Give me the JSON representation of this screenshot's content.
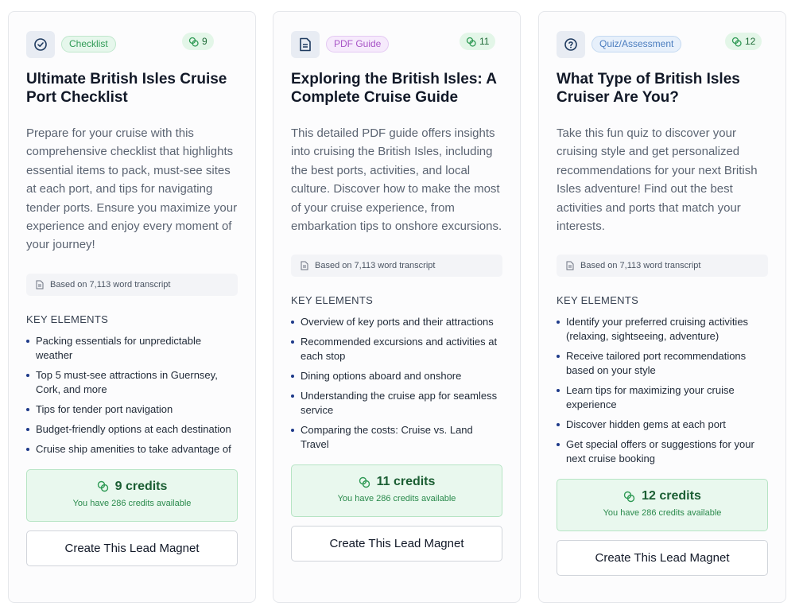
{
  "cards": [
    {
      "type_icon": "check-circle-icon",
      "type_label": "Checklist",
      "credit_count": "9",
      "title": "Ultimate British Isles Cruise Port Checklist",
      "description": "Prepare for your cruise with this comprehensive checklist that highlights essential items to pack, must-see sites at each port, and tips for navigating tender ports. Ensure you maximize your experience and enjoy every moment of your journey!",
      "transcript": "Based on 7,113 word transcript",
      "key_elements_title": "KEY ELEMENTS",
      "key_elements": [
        "Packing essentials for unpredictable weather",
        "Top 5 must-see attractions in Guernsey, Cork, and more",
        "Tips for tender port navigation",
        "Budget-friendly options at each destination",
        "Cruise ship amenities to take advantage of"
      ],
      "credits_label": "9 credits",
      "credits_available": "You have 286 credits available",
      "button_label": "Create This Lead Magnet"
    },
    {
      "type_icon": "document-icon",
      "type_label": "PDF Guide",
      "credit_count": "11",
      "title": "Exploring the British Isles: A Complete Cruise Guide",
      "description": "This detailed PDF guide offers insights into cruising the British Isles, including the best ports, activities, and local culture. Discover how to make the most of your cruise experience, from embarkation tips to onshore excursions.",
      "transcript": "Based on 7,113 word transcript",
      "key_elements_title": "KEY ELEMENTS",
      "key_elements": [
        "Overview of key ports and their attractions",
        "Recommended excursions and activities at each stop",
        "Dining options aboard and onshore",
        "Understanding the cruise app for seamless service",
        "Comparing the costs: Cruise vs. Land Travel"
      ],
      "credits_label": "11 credits",
      "credits_available": "You have 286 credits available",
      "button_label": "Create This Lead Magnet"
    },
    {
      "type_icon": "question-circle-icon",
      "type_label": "Quiz/Assessment",
      "credit_count": "12",
      "title": "What Type of British Isles Cruiser Are You?",
      "description": "Take this fun quiz to discover your cruising style and get personalized recommendations for your next British Isles adventure! Find out the best activities and ports that match your interests.",
      "transcript": "Based on 7,113 word transcript",
      "key_elements_title": "KEY ELEMENTS",
      "key_elements": [
        "Identify your preferred cruising activities (relaxing, sightseeing, adventure)",
        "Receive tailored port recommendations based on your style",
        "Learn tips for maximizing your cruise experience",
        "Discover hidden gems at each port",
        "Get special offers or suggestions for your next cruise booking"
      ],
      "credits_label": "12 credits",
      "credits_available": "You have 286 credits available",
      "button_label": "Create This Lead Magnet"
    }
  ],
  "colors": {
    "accent_green": "#1b5e33",
    "badge_checklist": "#2f9a55",
    "badge_pdf": "#a855c7",
    "badge_quiz": "#4b7dbf",
    "bullet": "#1e3a8a"
  }
}
